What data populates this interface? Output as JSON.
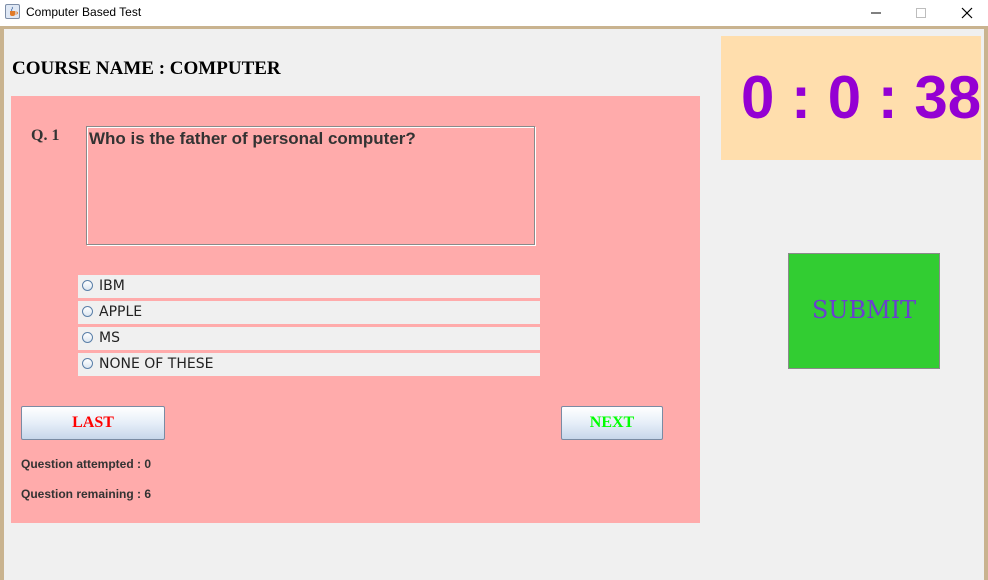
{
  "window": {
    "title": "Computer Based Test",
    "icon": "java-cup-icon"
  },
  "header": {
    "course_title": "COURSE NAME : COMPUTER"
  },
  "question": {
    "number": "Q. 1",
    "text": "Who is the father of personal computer?",
    "options": [
      "IBM",
      "APPLE",
      "MS",
      "NONE OF THESE"
    ]
  },
  "navigation": {
    "last_label": "LAST",
    "next_label": "NEXT"
  },
  "stats": {
    "attempted": "Question attempted : 0",
    "remaining": "Question remaining : 6"
  },
  "timer": {
    "display": "0 : 0 : 38"
  },
  "submit": {
    "label": "SUBMIT"
  },
  "colors": {
    "question_panel_bg": "#ffabab",
    "timer_bg": "#ffdead",
    "timer_text": "#9400d3",
    "submit_bg": "#32cd32",
    "submit_text": "#6a3fcf",
    "last_text": "#ff0000",
    "next_text": "#00ff00"
  }
}
